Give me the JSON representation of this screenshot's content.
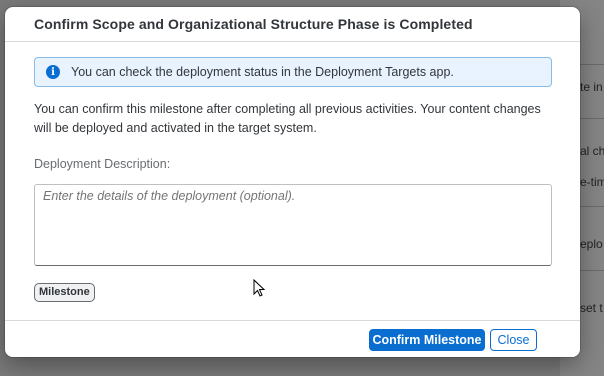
{
  "background": {
    "snippets": [
      "te in",
      "al ch",
      "e-tim",
      "eplo",
      "set t"
    ]
  },
  "dialog": {
    "title": "Confirm Scope and Organizational Structure Phase is Completed",
    "info_icon": "info-icon",
    "info_message": "You can check the deployment status in the Deployment Targets app.",
    "body_text": "You can confirm this milestone after completing all previous activities. Your content changes will be deployed and activated in the target system.",
    "description_label": "Deployment Description:",
    "description_value": "",
    "description_placeholder": "Enter the details of the deployment (optional).",
    "tag_label": "Milestone",
    "confirm_label": "Confirm Milestone",
    "close_label": "Close"
  },
  "colors": {
    "accent": "#0a6ed1",
    "info_background": "#e8f3ff",
    "overlay": "#7a7a7a"
  }
}
